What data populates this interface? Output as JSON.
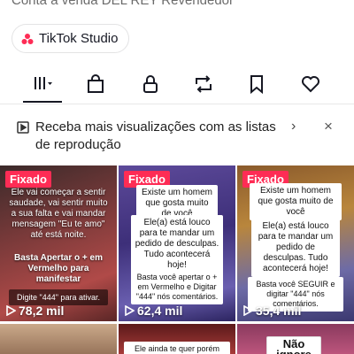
{
  "profile": {
    "bio": "Conta a venda DEL REY Revendedor",
    "studio_button": "TikTok Studio"
  },
  "tabs": [
    "videos-grid",
    "shop",
    "private",
    "reposts",
    "saved",
    "liked"
  ],
  "banner": {
    "text": "Receba mais visualizações com as listas de reprodução",
    "chevron": "›",
    "close": "×"
  },
  "videos": [
    {
      "badge": "Fixado",
      "caption_top": "Ele vai começar a sentir saudade, vai sentir muito a sua falta e vai mandar mensagem \"Eu te amo\" até está noite.",
      "caption_mid": "Basta Apertar o + em Vermelho para manifestar",
      "caption_bottom": "Digite \"444\" para ativar.",
      "views": "78,2 mil"
    },
    {
      "badge": "Fixado",
      "caption_top": "Existe um homem que gosta muito de você",
      "caption_mid": "Ele(a) está louco para te mandar um pedido de desculpas. Tudo acontecerá hoje!",
      "caption_bottom": "Basta você apertar o + em Vermelho e Digitar \"444\" nós comentários.",
      "views": "62,4 mil"
    },
    {
      "badge": "Fixado",
      "caption_top": "Existe um homem que gosta muito de você",
      "caption_mid": "Ele(a) está louco para te mandar um pedido de desculpas. Tudo acontecerá hoje!",
      "caption_bottom": "Basta você SEGUIR e digitar \"444\" nós comentários.",
      "views": "35,4 mil"
    }
  ],
  "row2": {
    "middle_caption": "Ele ainda te quer porém não",
    "right_caption": "Não ignore"
  },
  "colors": {
    "badge": "#fe2c55",
    "text": "#161823"
  }
}
